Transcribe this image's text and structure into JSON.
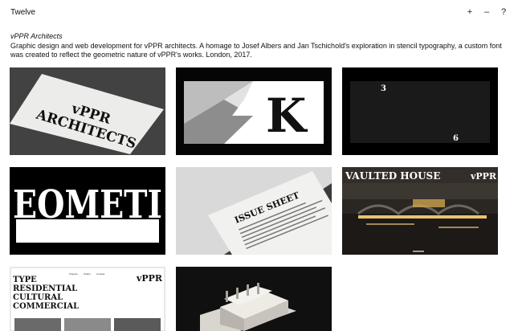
{
  "header": {
    "site_title": "Twelve",
    "actions": [
      {
        "icon": "plus-icon",
        "glyph": "+"
      },
      {
        "icon": "minus-icon",
        "glyph": "–"
      },
      {
        "icon": "help-icon",
        "glyph": "?"
      }
    ]
  },
  "project": {
    "title": "vPPR Architects",
    "description": "Graphic design and web development for vPPR architects. A homage to Josef Albers and Jan Tschichold's exploration in stencil typography, a custom font was created to reflect the geometric nature of vPPR's works. London, 2017."
  },
  "gallery": {
    "t1": {
      "line1": "vPPR",
      "line2": "ARCHITECTS"
    },
    "t2": {
      "letter": "K"
    },
    "t3": {
      "n1": "3",
      "n2": "6"
    },
    "t4": {
      "word": "EOMETI"
    },
    "t5": {
      "heading": "ISSUE SHEET"
    },
    "t6": {
      "left": "VAULTED HOUSE",
      "right": "vPPR"
    },
    "t7": {
      "logo": "vPPR",
      "nav": [
        "Projects",
        "Studio",
        "Contact"
      ],
      "lines": [
        "TYPE",
        "RESIDENTIAL",
        "CULTURAL",
        "COMMERCIAL"
      ]
    }
  },
  "colors": {
    "accent": "#111111",
    "background": "#ffffff",
    "warm_light": "#e8c36a"
  }
}
